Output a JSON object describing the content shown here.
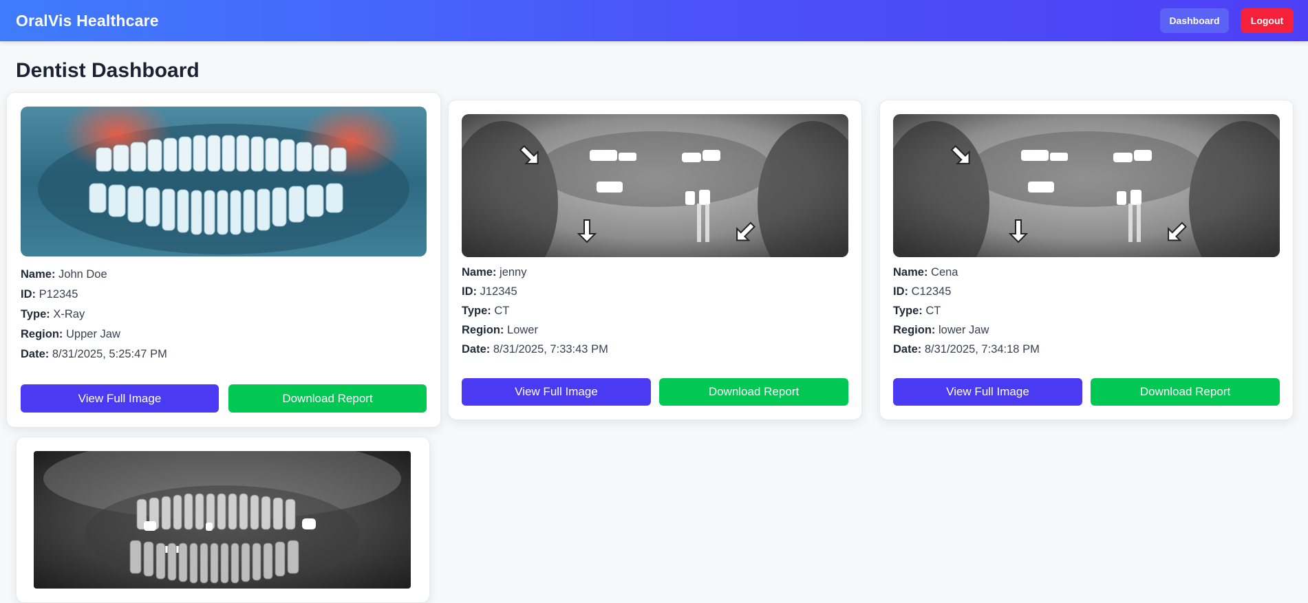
{
  "header": {
    "brand": "OralVis Healthcare",
    "dashboard_label": "Dashboard",
    "logout_label": "Logout"
  },
  "page": {
    "title": "Dentist Dashboard"
  },
  "labels": {
    "name": "Name:",
    "id": "ID:",
    "type": "Type:",
    "region": "Region:",
    "date": "Date:",
    "view_button": "View Full Image",
    "download_button": "Download Report"
  },
  "cards": [
    {
      "name": "John Doe",
      "id": "P12345",
      "type": "X-Ray",
      "region": "Upper Jaw",
      "date": "8/31/2025, 5:25:47 PM",
      "image": "panoramic-xray-blue"
    },
    {
      "name": "jenny",
      "id": "J12345",
      "type": "CT",
      "region": "Lower",
      "date": "8/31/2025, 7:33:43 PM",
      "image": "panoramic-xray-arrows"
    },
    {
      "name": "Cena",
      "id": "C12345",
      "type": "CT",
      "region": "lower Jaw",
      "date": "8/31/2025, 7:34:18 PM",
      "image": "panoramic-xray-arrows"
    },
    {
      "image": "panoramic-xray-gray"
    }
  ],
  "colors": {
    "header_gradient_start": "#3f7cfd",
    "header_gradient_end": "#4d3ff5",
    "logout": "#f5213b",
    "view_button": "#4a3af2",
    "download_button": "#00c853"
  }
}
